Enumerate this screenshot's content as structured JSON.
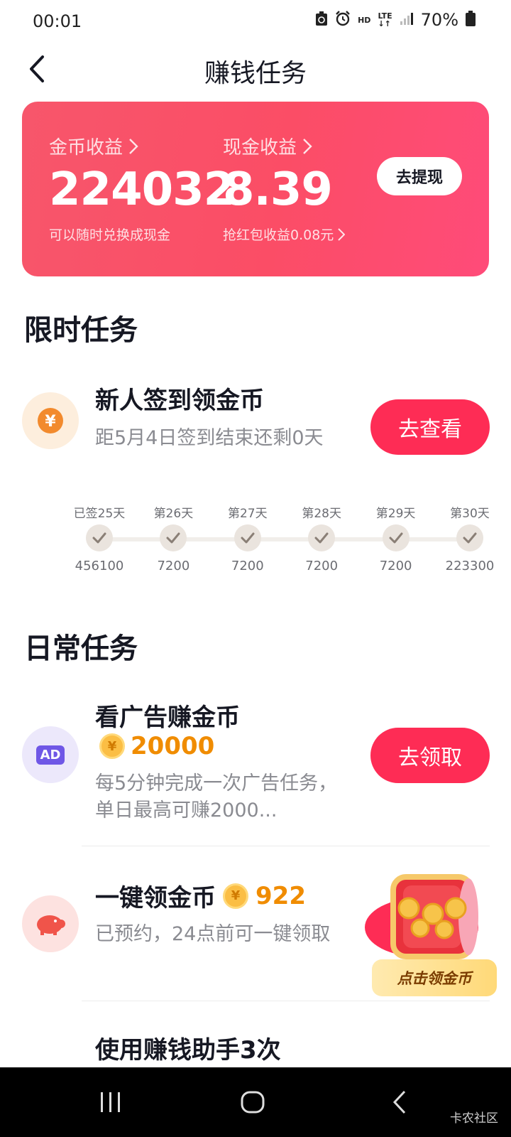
{
  "status_bar": {
    "time": "00:01",
    "network": "HD",
    "lte": "LTE",
    "battery": "70%"
  },
  "header": {
    "title": "赚钱任务"
  },
  "earnings": {
    "coin_label": "金币收益",
    "coin_value": "224032",
    "coin_sub": "可以随时兑换成现金",
    "cash_label": "现金收益",
    "cash_value": "8.39",
    "cash_sub": "抢红包收益0.08元",
    "withdraw_label": "去提现"
  },
  "limited": {
    "section_title": "限时任务",
    "task": {
      "name": "新人签到领金币",
      "desc": "距5月4日签到结束还剩0天",
      "button": "去查看",
      "icon": "yuan-coin-icon"
    },
    "checkin_days": [
      {
        "label": "已签25天",
        "reward": "456100"
      },
      {
        "label": "第26天",
        "reward": "7200"
      },
      {
        "label": "第27天",
        "reward": "7200"
      },
      {
        "label": "第28天",
        "reward": "7200"
      },
      {
        "label": "第29天",
        "reward": "7200"
      },
      {
        "label": "第30天",
        "reward": "223300"
      }
    ]
  },
  "daily": {
    "section_title": "日常任务",
    "ad_task": {
      "name": "看广告赚金币",
      "icon_text": "AD",
      "coin_amount": "20000",
      "desc": "每5分钟完成一次广告任务，单日最高可赚2000...",
      "button": "去领取"
    },
    "one_click_task": {
      "name": "一键领金币",
      "coin_amount": "922",
      "desc": "已预约，24点前可一键领取",
      "promo_label": "点击领金币"
    },
    "helper_task": {
      "name": "使用赚钱助手3次"
    }
  },
  "coin_symbol": "¥",
  "watermark": "卡农社区",
  "colors": {
    "accent": "#fe2c55",
    "coin": "#f08c00",
    "card_start": "#f7566b",
    "card_end": "#ff4b79"
  }
}
